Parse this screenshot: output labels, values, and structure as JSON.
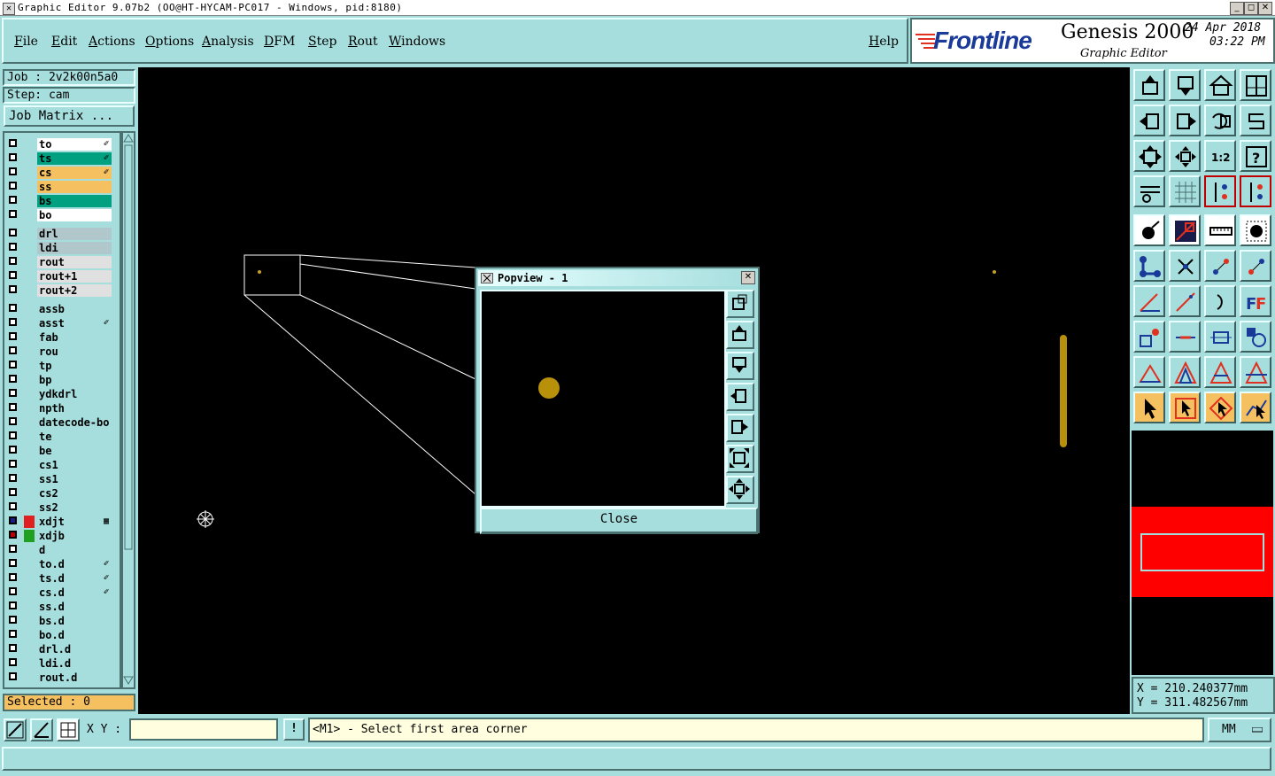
{
  "window": {
    "title": "Graphic Editor 9.07b2 (OO@HT-HYCAM-PC017 - Windows, pid:8180)",
    "minimize": "_",
    "maximize": "◻",
    "close": "✕"
  },
  "menu": {
    "items": [
      "File",
      "Edit",
      "Actions",
      "Options",
      "Analysis",
      "DFM",
      "Step",
      "Rout",
      "Windows"
    ],
    "help": "Help"
  },
  "brand": {
    "logo": "Frontline",
    "product": "Genesis 2000",
    "subtitle": "Graphic Editor",
    "date": "24 Apr 2018",
    "time": "03:22 PM"
  },
  "job": {
    "job_label": "Job : 2v2k00n5a0",
    "step_label": "Step: cam",
    "matrix_button": "Job Matrix ..."
  },
  "layers": [
    {
      "name": "to",
      "color": "#ffffff",
      "mark": "✐"
    },
    {
      "name": "ts",
      "color": "#00a080",
      "mark": "✐"
    },
    {
      "name": "cs",
      "color": "#f5c060",
      "mark": "✐"
    },
    {
      "name": "ss",
      "color": "#f5c060",
      "mark": ""
    },
    {
      "name": "bs",
      "color": "#00a080",
      "mark": ""
    },
    {
      "name": "bo",
      "color": "#ffffff",
      "mark": ""
    },
    {
      "name": "drl",
      "color": "#b0c8cc",
      "mark": ""
    },
    {
      "name": "ldi",
      "color": "#b0c8cc",
      "mark": ""
    },
    {
      "name": "rout",
      "color": "#e0e0e0",
      "mark": ""
    },
    {
      "name": "rout+1",
      "color": "#e0e0e0",
      "mark": ""
    },
    {
      "name": "rout+2",
      "color": "#e0e0e0",
      "mark": ""
    },
    {
      "name": "assb",
      "color": "#a6dede",
      "mark": ""
    },
    {
      "name": "asst",
      "color": "#a6dede",
      "mark": "✐"
    },
    {
      "name": "fab",
      "color": "#a6dede",
      "mark": ""
    },
    {
      "name": "rou",
      "color": "#a6dede",
      "mark": ""
    },
    {
      "name": "tp",
      "color": "#a6dede",
      "mark": ""
    },
    {
      "name": "bp",
      "color": "#a6dede",
      "mark": ""
    },
    {
      "name": "ydkdrl",
      "color": "#a6dede",
      "mark": ""
    },
    {
      "name": "npth",
      "color": "#a6dede",
      "mark": ""
    },
    {
      "name": "datecode-bo",
      "color": "#a6dede",
      "mark": ""
    },
    {
      "name": "te",
      "color": "#a6dede",
      "mark": ""
    },
    {
      "name": "be",
      "color": "#a6dede",
      "mark": ""
    },
    {
      "name": "cs1",
      "color": "#a6dede",
      "mark": ""
    },
    {
      "name": "ss1",
      "color": "#a6dede",
      "mark": ""
    },
    {
      "name": "cs2",
      "color": "#a6dede",
      "mark": ""
    },
    {
      "name": "ss2",
      "color": "#a6dede",
      "mark": ""
    },
    {
      "name": "xdjt",
      "color": "#a6dede",
      "mark": "▦"
    },
    {
      "name": "xdjb",
      "color": "#a6dede",
      "mark": ""
    },
    {
      "name": "d",
      "color": "#a6dede",
      "mark": ""
    },
    {
      "name": "to.d",
      "color": "#a6dede",
      "mark": "✐"
    },
    {
      "name": "ts.d",
      "color": "#a6dede",
      "mark": "✐"
    },
    {
      "name": "cs.d",
      "color": "#a6dede",
      "mark": "✐"
    },
    {
      "name": "ss.d",
      "color": "#a6dede",
      "mark": ""
    },
    {
      "name": "bs.d",
      "color": "#a6dede",
      "mark": ""
    },
    {
      "name": "bo.d",
      "color": "#a6dede",
      "mark": ""
    },
    {
      "name": "drl.d",
      "color": "#a6dede",
      "mark": ""
    },
    {
      "name": "ldi.d",
      "color": "#a6dede",
      "mark": ""
    },
    {
      "name": "rout.d",
      "color": "#a6dede",
      "mark": ""
    }
  ],
  "selected": "Selected : 0",
  "coords": {
    "x": "X  =  210.240377mm",
    "y": "Y  =  311.482567mm"
  },
  "bottom": {
    "xy_label": "X Y :",
    "info_icon": "!",
    "message": "<M1> - Select first area corner",
    "unit": "MM"
  },
  "popview": {
    "title": "Popview - 1",
    "close_label": "Close",
    "close_x": "✕"
  },
  "colors": {
    "panel": "#a6dede",
    "pad": "#b8900a",
    "overview_red": "#ff0000",
    "selected_bg": "#f5c060"
  }
}
